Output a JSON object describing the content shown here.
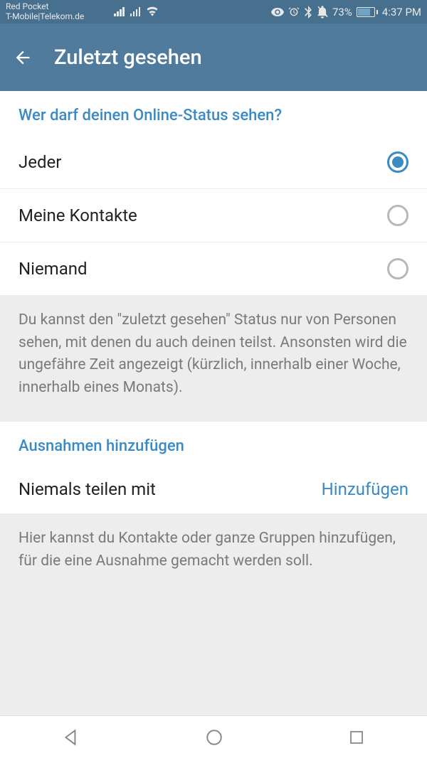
{
  "status_bar": {
    "carrier1": "Red Pocket",
    "carrier2": "T-Mobile|Telekom.de",
    "battery_pct": "73%",
    "time": "4:37 PM"
  },
  "app_bar": {
    "title": "Zuletzt gesehen"
  },
  "section1": {
    "header": "Wer darf deinen Online-Status sehen?",
    "options": [
      {
        "label": "Jeder",
        "selected": true
      },
      {
        "label": "Meine Kontakte",
        "selected": false
      },
      {
        "label": "Niemand",
        "selected": false
      }
    ],
    "info": "Du kannst den \"zuletzt gesehen\" Status nur von Personen sehen, mit denen du auch deinen teilst. Ansonsten wird die ungefähre Zeit angezeigt (kürzlich, innerhalb einer Woche, innerhalb eines Monats)."
  },
  "section2": {
    "header": "Ausnahmen hinzufügen",
    "action_label": "Niemals teilen mit",
    "action_link": "Hinzufügen",
    "info": "Hier kannst du Kontakte oder ganze Gruppen hinzufügen, für die eine Ausnahme gemacht werden soll."
  }
}
